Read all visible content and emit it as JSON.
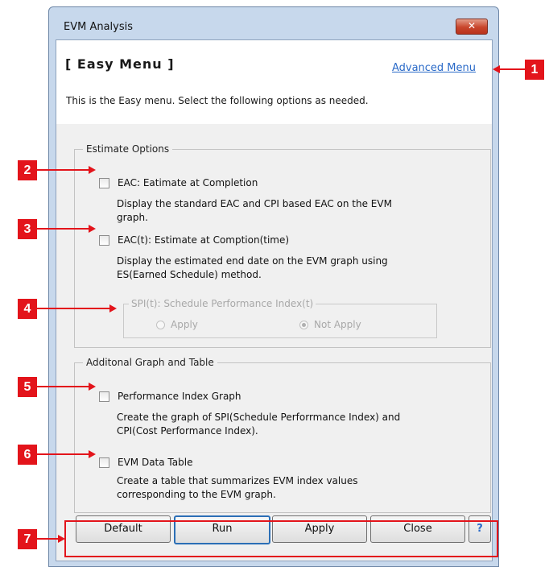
{
  "window": {
    "title": "EVM Analysis",
    "close_label": "✕"
  },
  "header": {
    "menu_title": "[ Easy Menu ]",
    "advanced_link": "Advanced Menu",
    "intro": "This is the Easy menu. Select the following options as needed."
  },
  "estimate_options": {
    "legend": "Estimate Options",
    "eac": {
      "label": "EAC: Eatimate at Completion",
      "checked": false,
      "desc_line1": "Display the standard EAC and CPI based EAC on the EVM",
      "desc_line2": "graph."
    },
    "eact": {
      "label": "EAC(t): Estimate at Comption(time)",
      "checked": false,
      "desc_line1": "Display the estimated end date on the EVM graph using",
      "desc_line2": "ES(Earned Schedule) method."
    },
    "spi": {
      "legend": "SPI(t): Schedule Performance Index(t)",
      "apply": "Apply",
      "not_apply": "Not Apply",
      "selected": "Not Apply",
      "enabled": false
    }
  },
  "additional": {
    "legend": "Additonal Graph and Table",
    "perf": {
      "label": "Performance Index Graph",
      "checked": false,
      "desc_line1": "Create the graph of SPI(Schedule Perforrmance Index) and",
      "desc_line2": "CPI(Cost Performance Index)."
    },
    "table": {
      "label": "EVM Data Table",
      "checked": false,
      "desc_line1": "Create a table that summarizes EVM index values",
      "desc_line2": "corresponding to the EVM graph."
    }
  },
  "buttons": {
    "default": "Default",
    "run": "Run",
    "apply": "Apply",
    "close": "Close",
    "help": "?"
  },
  "annotations": {
    "n1": "1",
    "n2": "2",
    "n3": "3",
    "n4": "4",
    "n5": "5",
    "n6": "6",
    "n7": "7",
    "color": "#e3141b"
  }
}
